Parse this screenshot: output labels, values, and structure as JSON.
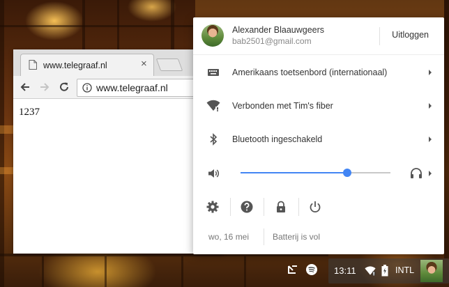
{
  "browser": {
    "tab": {
      "title": "www.telegraaf.nl",
      "close_icon": "×"
    },
    "address_bar": {
      "url": "www.telegraaf.nl"
    },
    "page_text": "1237"
  },
  "tray": {
    "user": {
      "name": "Alexander Blaauwgeers",
      "email": "bab2501@gmail.com",
      "logout_label": "Uitloggen"
    },
    "items": [
      {
        "icon": "keyboard-icon",
        "label": "Amerikaans toetsenbord (internationaal)"
      },
      {
        "icon": "wifi-icon",
        "label": "Verbonden met Tim's fiber"
      },
      {
        "icon": "bluetooth-icon",
        "label": "Bluetooth ingeschakeld"
      }
    ],
    "volume": {
      "level": 0.71,
      "output_icon": "headphones-icon"
    },
    "actions": [
      "settings-icon",
      "help-icon",
      "lock-icon",
      "power-icon"
    ],
    "footer": {
      "date": "wo, 16 mei",
      "battery": "Batterij is vol"
    },
    "accent_color": "#4285f4"
  },
  "shelf": {
    "time": "13:11",
    "input_method": "INTL"
  }
}
